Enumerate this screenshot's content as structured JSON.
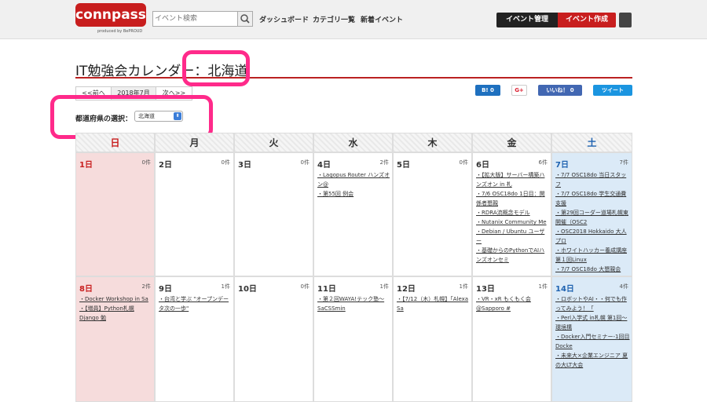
{
  "header": {
    "logo": "connpass",
    "logo_sub": "produced by BePROUD",
    "search_placeholder": "イベント検索",
    "nav": [
      "ダッシュボード",
      "カテゴリ一覧",
      "新着イベント"
    ],
    "btn_manage": "イベント管理",
    "btn_create": "イベント作成"
  },
  "page": {
    "title_prefix": "IT勉強会カレンダー：",
    "title_region": "北海道"
  },
  "pager": {
    "prev": "<<前へ",
    "current": "2018年7月",
    "next": "次へ>>"
  },
  "share": {
    "hatena": "B! 0",
    "gplus": "G+",
    "like": "いいね！ 0",
    "tweet": "ツイート"
  },
  "prefecture": {
    "label": "都道府県の選択：",
    "selected": "北海道"
  },
  "weekdays": [
    "日",
    "月",
    "火",
    "水",
    "木",
    "金",
    "土"
  ],
  "weeks": [
    [
      {
        "day": "1日",
        "count": "0件",
        "events": []
      },
      {
        "day": "2日",
        "count": "0件",
        "events": []
      },
      {
        "day": "3日",
        "count": "0件",
        "events": []
      },
      {
        "day": "4日",
        "count": "2件",
        "events": [
          "Lagopus Router ハンズオン@",
          "第55回 例会"
        ]
      },
      {
        "day": "5日",
        "count": "0件",
        "events": []
      },
      {
        "day": "6日",
        "count": "6件",
        "events": [
          "【拡大版】サーバー構築ハンズオン in 札",
          "7/6 OSC18do 1日目：関係者懇親",
          "RDRA流概念モデル",
          "Nutanix Community Me",
          "Debian / Ubuntu ユーザー",
          "基礎からのPythonでAIハンズオンセミ"
        ]
      },
      {
        "day": "7日",
        "count": "7件",
        "events": [
          "7/7 OSC18do 当日スタッフ",
          "7/7 OSC18do 学生交通費支援",
          "第29回コーダー道場札幌東 開催（OSC2",
          "OSC2018 Hokkaido 大人プロ",
          "ホワイトハッカー養成講座 第１回Linux",
          "7/7 OSC18do 大懇親会"
        ]
      }
    ],
    [
      {
        "day": "8日",
        "count": "2件",
        "events": [
          "Docker Workshop in Sa",
          "【増員】Python札幌 Django 勉"
        ]
      },
      {
        "day": "9日",
        "count": "1件",
        "events": [
          "台湾と学ぶ \"オープンデータ次の一歩\""
        ]
      },
      {
        "day": "10日",
        "count": "0件",
        "events": []
      },
      {
        "day": "11日",
        "count": "1件",
        "events": [
          "第２回WAYA!テック塾〜SaCSSmin"
        ]
      },
      {
        "day": "12日",
        "count": "1件",
        "events": [
          "【7/12（木）札幌】「Alexa Sa"
        ]
      },
      {
        "day": "13日",
        "count": "1件",
        "events": [
          "VR・xR もくもく会@Sapporo #"
        ]
      },
      {
        "day": "14日",
        "count": "4件",
        "events": [
          "ロボットやAI・・何でも作ってみよう！「",
          "Perl入学式 in札幌 第1回〜環境構",
          "Docker入門セミナー-1回目Docke",
          "未来大×企業エンジニア 夏の大LT大会"
        ]
      }
    ]
  ],
  "colors": {
    "sunday": "#c81e1e",
    "saturday": "#1e62b0",
    "highlight": "#ff2a8a",
    "brand": "#c81e1e"
  }
}
